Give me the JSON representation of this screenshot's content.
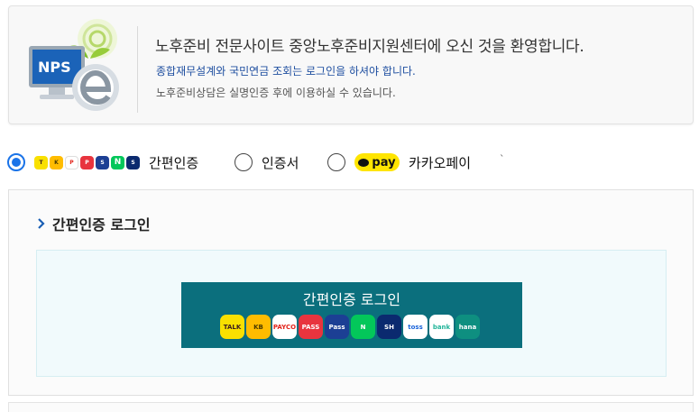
{
  "welcome": {
    "logo_text": "NPS",
    "title": "노후준비 전문사이트 중앙노후준비지원센터에 오신 것을 환영합니다.",
    "note_blue": "종합재무설계와 국민연금 조회는 로그인을 하셔야 합니다.",
    "note_gray": "노후준비상담은 실명인증 후에 이용하실 수 있습니다."
  },
  "auth_options": [
    {
      "label": "간편인증",
      "selected": true
    },
    {
      "label": "인증서",
      "selected": false
    },
    {
      "label": "카카오페이",
      "selected": false,
      "badge": "pay"
    }
  ],
  "options_mini_icons": [
    "TALK",
    "KB",
    "PAYCO",
    "PASS",
    "Pass",
    "N",
    "SH"
  ],
  "stray_mark": "`",
  "login_panel": {
    "title": "간편인증 로그인",
    "button_label": "간편인증 로그인",
    "button_icons": [
      {
        "name": "kakaotalk-icon",
        "text": "TALK",
        "bg": "#f9e000",
        "fg": "#3c1e1e"
      },
      {
        "name": "kb-icon",
        "text": "KB",
        "bg": "#ffbc00",
        "fg": "#4a3b00"
      },
      {
        "name": "payco-icon",
        "text": "PAYCO",
        "bg": "#ffffff",
        "fg": "#e2231a"
      },
      {
        "name": "pass-icon",
        "text": "PASS",
        "bg": "#e8343e",
        "fg": "#ffffff"
      },
      {
        "name": "samsung-pass-icon",
        "text": "Pass",
        "bg": "#1c3f94",
        "fg": "#ffffff"
      },
      {
        "name": "naver-icon",
        "text": "N",
        "bg": "#03c75a",
        "fg": "#ffffff"
      },
      {
        "name": "shinhan-icon",
        "text": "SH",
        "bg": "#0b2a6f",
        "fg": "#ffffff"
      },
      {
        "name": "toss-icon",
        "text": "toss",
        "bg": "#ffffff",
        "fg": "#1b64da"
      },
      {
        "name": "bank-sal-icon",
        "text": "bank",
        "bg": "#ffffff",
        "fg": "#22b59a"
      },
      {
        "name": "hana-icon",
        "text": "hana",
        "bg": "#0e8f80",
        "fg": "#ffffff"
      }
    ]
  },
  "colors": {
    "accent": "#1a73e8",
    "button_bg": "#0b6f7d",
    "kakaopay_yellow": "#ffe500",
    "note_blue": "#1f4fa0"
  }
}
